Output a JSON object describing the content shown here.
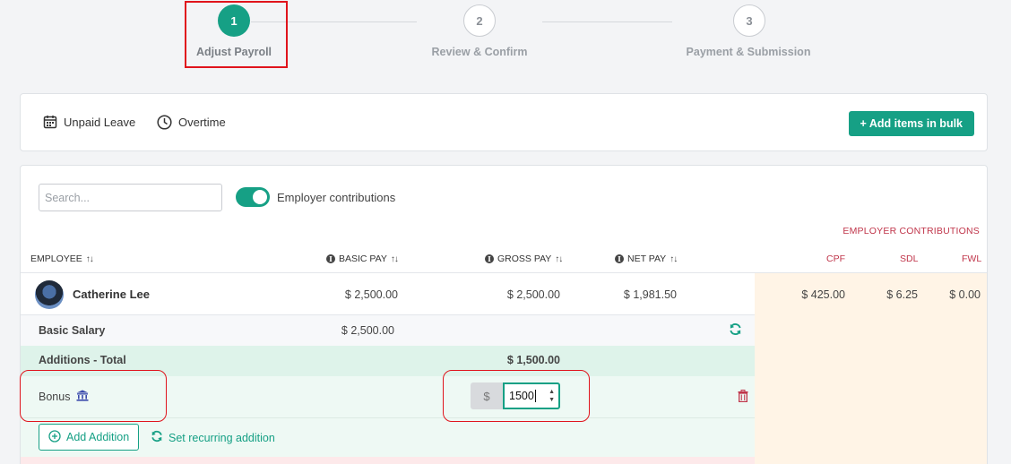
{
  "stepper": {
    "steps": [
      {
        "number": "1",
        "label": "Adjust Payroll"
      },
      {
        "number": "2",
        "label": "Review & Confirm"
      },
      {
        "number": "3",
        "label": "Payment & Submission"
      }
    ],
    "active_step": 1
  },
  "toolbar": {
    "unpaid_leave": "Unpaid Leave",
    "overtime": "Overtime",
    "bulk_button": "+ Add items in bulk"
  },
  "controls": {
    "search_placeholder": "Search...",
    "toggle_label": "Employer contributions",
    "toggle_on": true
  },
  "table": {
    "employer_title": "EMPLOYER CONTRIBUTIONS",
    "columns": {
      "employee": "EMPLOYEE",
      "basic_pay": "BASIC PAY",
      "gross_pay": "GROSS PAY",
      "net_pay": "NET PAY",
      "cpf": "CPF",
      "sdl": "SDL",
      "fwl": "FWL"
    },
    "employee": {
      "name": "Catherine Lee",
      "basic_pay": "$ 2,500.00",
      "gross_pay": "$ 2,500.00",
      "net_pay": "$ 1,981.50",
      "cpf": "$ 425.00",
      "sdl": "$ 6.25",
      "fwl": "$ 0.00"
    },
    "basic_salary": {
      "label": "Basic Salary",
      "amount": "$ 2,500.00"
    },
    "additions": {
      "label": "Additions - Total",
      "amount": "$ 1,500.00"
    },
    "bonus": {
      "label": "Bonus",
      "currency": "$",
      "value": "1500"
    },
    "add_addition": "Add Addition",
    "set_recurring": "Set recurring addition"
  },
  "colors": {
    "accent": "#16a085",
    "employer": "#c0354a",
    "annotation": "#e0141c",
    "peach": "#fff4e6"
  },
  "icons": [
    "calendar-icon",
    "clock-icon",
    "info-icon",
    "sort-icon",
    "refresh-icon",
    "bank-icon",
    "trash-icon",
    "plus-circle-icon"
  ]
}
